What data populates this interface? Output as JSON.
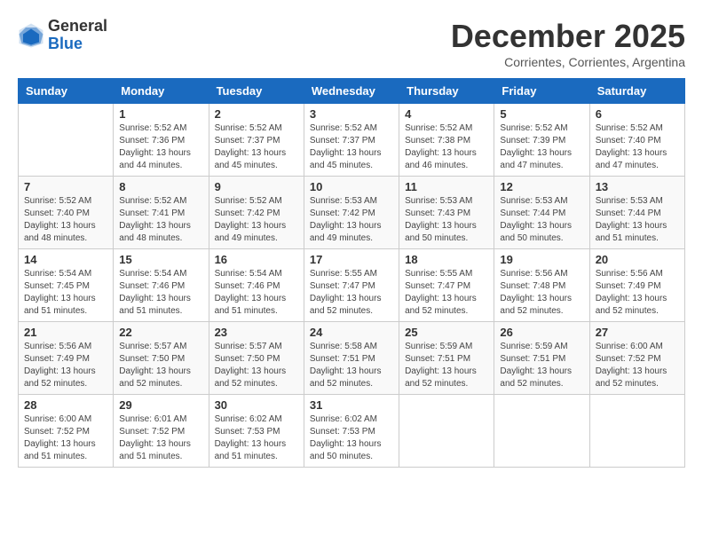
{
  "logo": {
    "general": "General",
    "blue": "Blue"
  },
  "header": {
    "month": "December 2025",
    "location": "Corrientes, Corrientes, Argentina"
  },
  "days_of_week": [
    "Sunday",
    "Monday",
    "Tuesday",
    "Wednesday",
    "Thursday",
    "Friday",
    "Saturday"
  ],
  "weeks": [
    [
      {
        "day": "",
        "info": ""
      },
      {
        "day": "1",
        "info": "Sunrise: 5:52 AM\nSunset: 7:36 PM\nDaylight: 13 hours\nand 44 minutes."
      },
      {
        "day": "2",
        "info": "Sunrise: 5:52 AM\nSunset: 7:37 PM\nDaylight: 13 hours\nand 45 minutes."
      },
      {
        "day": "3",
        "info": "Sunrise: 5:52 AM\nSunset: 7:37 PM\nDaylight: 13 hours\nand 45 minutes."
      },
      {
        "day": "4",
        "info": "Sunrise: 5:52 AM\nSunset: 7:38 PM\nDaylight: 13 hours\nand 46 minutes."
      },
      {
        "day": "5",
        "info": "Sunrise: 5:52 AM\nSunset: 7:39 PM\nDaylight: 13 hours\nand 47 minutes."
      },
      {
        "day": "6",
        "info": "Sunrise: 5:52 AM\nSunset: 7:40 PM\nDaylight: 13 hours\nand 47 minutes."
      }
    ],
    [
      {
        "day": "7",
        "info": "Sunrise: 5:52 AM\nSunset: 7:40 PM\nDaylight: 13 hours\nand 48 minutes."
      },
      {
        "day": "8",
        "info": "Sunrise: 5:52 AM\nSunset: 7:41 PM\nDaylight: 13 hours\nand 48 minutes."
      },
      {
        "day": "9",
        "info": "Sunrise: 5:52 AM\nSunset: 7:42 PM\nDaylight: 13 hours\nand 49 minutes."
      },
      {
        "day": "10",
        "info": "Sunrise: 5:53 AM\nSunset: 7:42 PM\nDaylight: 13 hours\nand 49 minutes."
      },
      {
        "day": "11",
        "info": "Sunrise: 5:53 AM\nSunset: 7:43 PM\nDaylight: 13 hours\nand 50 minutes."
      },
      {
        "day": "12",
        "info": "Sunrise: 5:53 AM\nSunset: 7:44 PM\nDaylight: 13 hours\nand 50 minutes."
      },
      {
        "day": "13",
        "info": "Sunrise: 5:53 AM\nSunset: 7:44 PM\nDaylight: 13 hours\nand 51 minutes."
      }
    ],
    [
      {
        "day": "14",
        "info": "Sunrise: 5:54 AM\nSunset: 7:45 PM\nDaylight: 13 hours\nand 51 minutes."
      },
      {
        "day": "15",
        "info": "Sunrise: 5:54 AM\nSunset: 7:46 PM\nDaylight: 13 hours\nand 51 minutes."
      },
      {
        "day": "16",
        "info": "Sunrise: 5:54 AM\nSunset: 7:46 PM\nDaylight: 13 hours\nand 51 minutes."
      },
      {
        "day": "17",
        "info": "Sunrise: 5:55 AM\nSunset: 7:47 PM\nDaylight: 13 hours\nand 52 minutes."
      },
      {
        "day": "18",
        "info": "Sunrise: 5:55 AM\nSunset: 7:47 PM\nDaylight: 13 hours\nand 52 minutes."
      },
      {
        "day": "19",
        "info": "Sunrise: 5:56 AM\nSunset: 7:48 PM\nDaylight: 13 hours\nand 52 minutes."
      },
      {
        "day": "20",
        "info": "Sunrise: 5:56 AM\nSunset: 7:49 PM\nDaylight: 13 hours\nand 52 minutes."
      }
    ],
    [
      {
        "day": "21",
        "info": "Sunrise: 5:56 AM\nSunset: 7:49 PM\nDaylight: 13 hours\nand 52 minutes."
      },
      {
        "day": "22",
        "info": "Sunrise: 5:57 AM\nSunset: 7:50 PM\nDaylight: 13 hours\nand 52 minutes."
      },
      {
        "day": "23",
        "info": "Sunrise: 5:57 AM\nSunset: 7:50 PM\nDaylight: 13 hours\nand 52 minutes."
      },
      {
        "day": "24",
        "info": "Sunrise: 5:58 AM\nSunset: 7:51 PM\nDaylight: 13 hours\nand 52 minutes."
      },
      {
        "day": "25",
        "info": "Sunrise: 5:59 AM\nSunset: 7:51 PM\nDaylight: 13 hours\nand 52 minutes."
      },
      {
        "day": "26",
        "info": "Sunrise: 5:59 AM\nSunset: 7:51 PM\nDaylight: 13 hours\nand 52 minutes."
      },
      {
        "day": "27",
        "info": "Sunrise: 6:00 AM\nSunset: 7:52 PM\nDaylight: 13 hours\nand 52 minutes."
      }
    ],
    [
      {
        "day": "28",
        "info": "Sunrise: 6:00 AM\nSunset: 7:52 PM\nDaylight: 13 hours\nand 51 minutes."
      },
      {
        "day": "29",
        "info": "Sunrise: 6:01 AM\nSunset: 7:52 PM\nDaylight: 13 hours\nand 51 minutes."
      },
      {
        "day": "30",
        "info": "Sunrise: 6:02 AM\nSunset: 7:53 PM\nDaylight: 13 hours\nand 51 minutes."
      },
      {
        "day": "31",
        "info": "Sunrise: 6:02 AM\nSunset: 7:53 PM\nDaylight: 13 hours\nand 50 minutes."
      },
      {
        "day": "",
        "info": ""
      },
      {
        "day": "",
        "info": ""
      },
      {
        "day": "",
        "info": ""
      }
    ]
  ]
}
